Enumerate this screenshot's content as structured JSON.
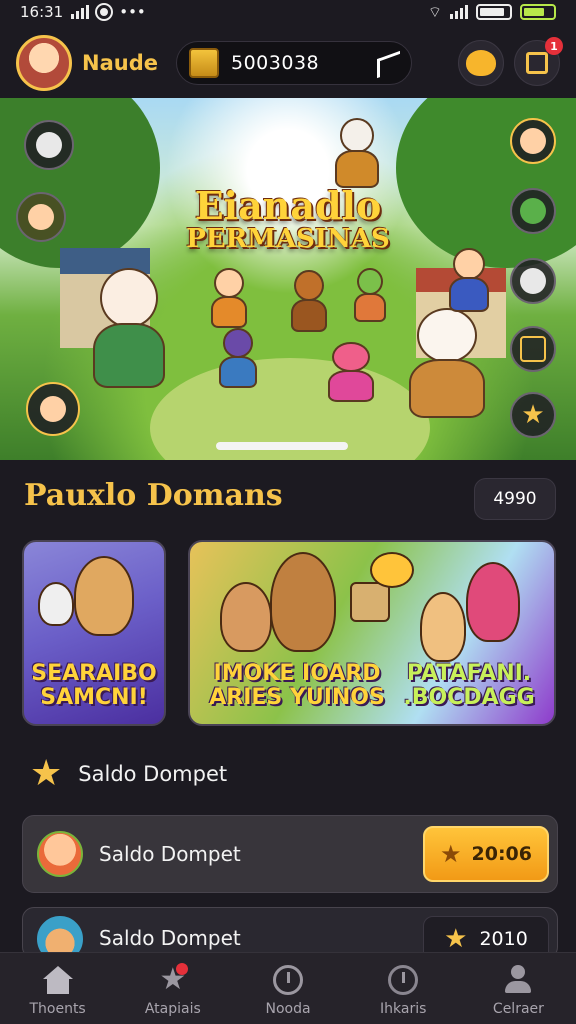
{
  "status_bar": {
    "time": "16:31",
    "icons": [
      "signal-icon",
      "notification-dot-icon",
      "more-dots-icon",
      "wifi-icon",
      "signal-icon",
      "battery-icon",
      "battery-charging-icon"
    ]
  },
  "header": {
    "username": "Naude",
    "coins": "5003038",
    "notification_count": "1",
    "icons": [
      "avatar",
      "treasure-box-icon",
      "share-icon",
      "emote-icon",
      "edit-icon"
    ]
  },
  "hero": {
    "title_line1": "Eianadlo",
    "title_line2": "PERMASINAS"
  },
  "section": {
    "title": "Pauxlo Domans",
    "count": "4990"
  },
  "cards": [
    {
      "caption_line1": "SEARAIBO",
      "caption_line2": "SAMCNI!"
    },
    {
      "caption_left_line1": "IMOKE IOARD",
      "caption_left_line2": "ARIES YUINOS",
      "caption_right_line1": "PATAFANI.",
      "caption_right_line2": ".BOCDAGG"
    }
  ],
  "wallet": {
    "label": "Saldo Dompet",
    "rows": [
      {
        "label": "Saldo Dompet",
        "value": "20:06"
      },
      {
        "label": "Saldo Dompet",
        "value": "2010"
      }
    ]
  },
  "bottom_nav": [
    {
      "label": "Thoents",
      "icon": "home-icon"
    },
    {
      "label": "Atapiais",
      "icon": "star-icon"
    },
    {
      "label": "Nooda",
      "icon": "clock-icon"
    },
    {
      "label": "Ihkaris",
      "icon": "timer-icon"
    },
    {
      "label": "Celraer",
      "icon": "user-icon"
    }
  ],
  "colors": {
    "accent_gold": "#f6c34b",
    "background": "#1c1a21",
    "badge_red": "#e5303a"
  }
}
